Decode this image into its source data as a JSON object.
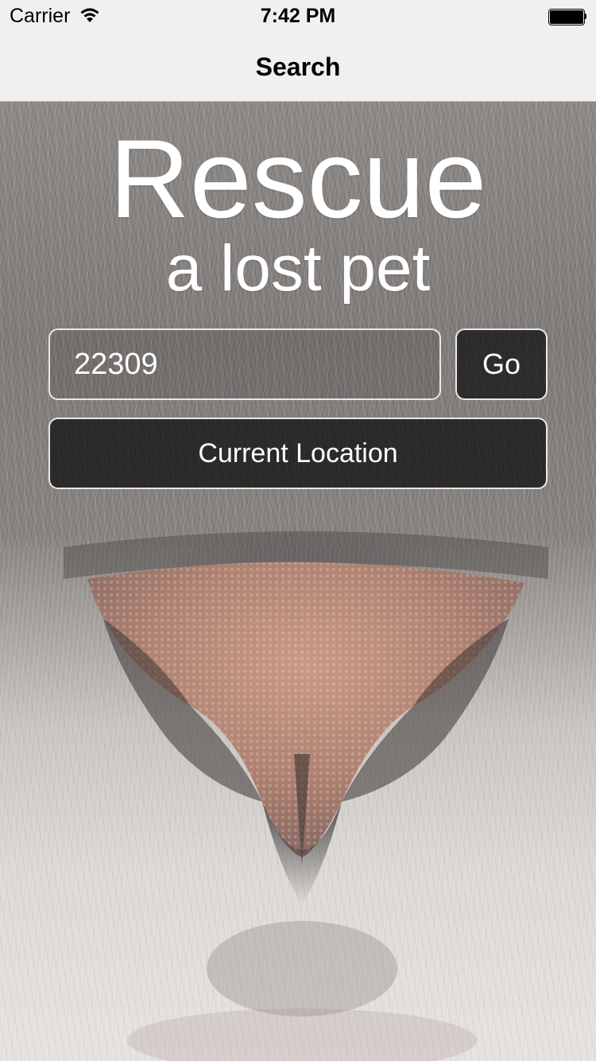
{
  "status_bar": {
    "carrier": "Carrier",
    "time": "7:42 PM",
    "wifi_icon": "wifi-icon",
    "battery_icon": "battery-full-icon"
  },
  "nav": {
    "title": "Search"
  },
  "hero": {
    "title": "Rescue",
    "subtitle": "a lost pet"
  },
  "search": {
    "zip_value": "22309",
    "go_label": "Go",
    "current_location_label": "Current Location"
  },
  "background": {
    "image": "cat-nose-photo"
  },
  "colors": {
    "bar_background": "#f1f0ee",
    "text_on_image": "#ffffff",
    "button_fill": "#0a0a0a",
    "button_border": "#e8e8e8"
  }
}
